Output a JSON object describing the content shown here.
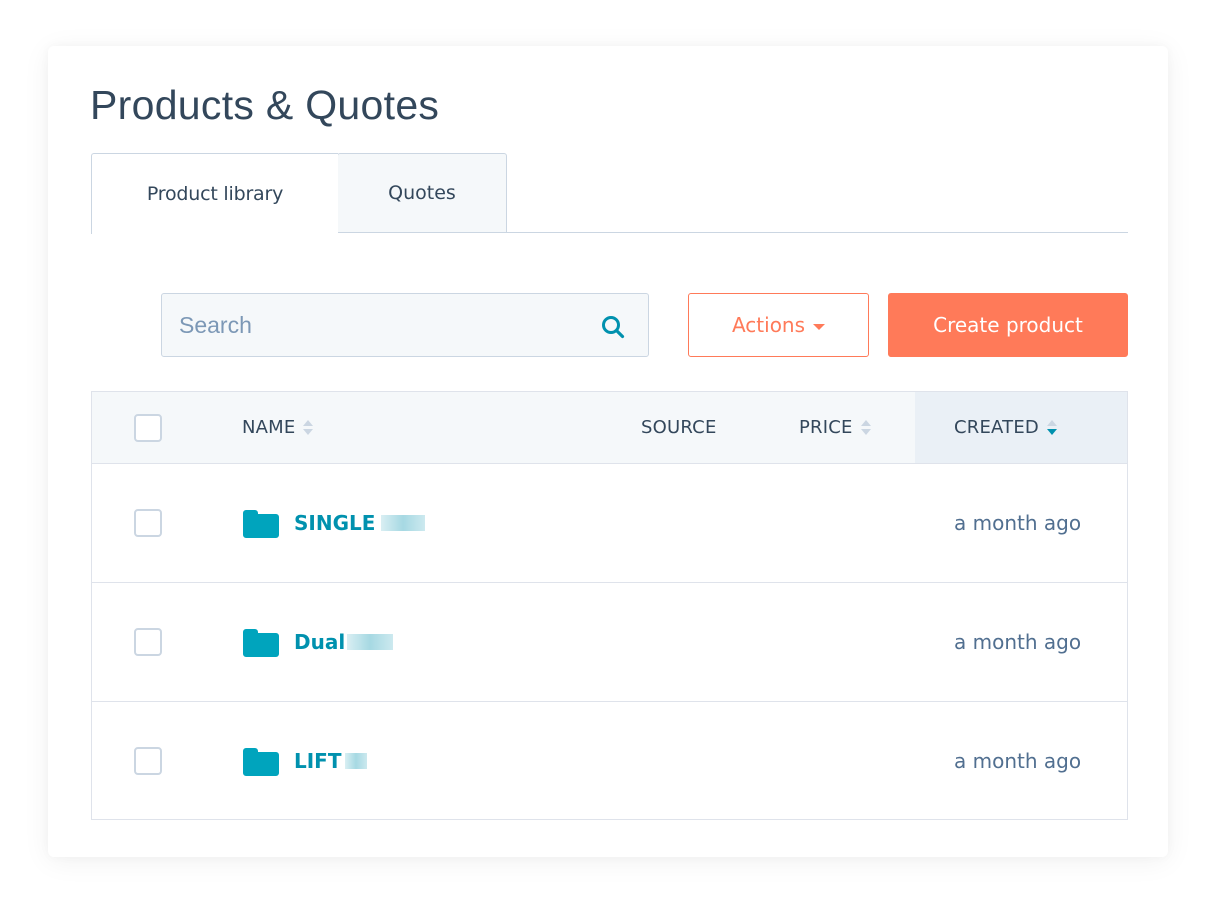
{
  "page": {
    "title": "Products & Quotes"
  },
  "tabs": [
    {
      "label": "Product library",
      "active": true
    },
    {
      "label": "Quotes",
      "active": false
    }
  ],
  "toolbar": {
    "search_placeholder": "Search",
    "search_value": "",
    "search_icon": "search-icon",
    "actions_label": "Actions",
    "create_label": "Create product"
  },
  "colors": {
    "accent": "#ff7a59",
    "link": "#0091ae",
    "text": "#33475b",
    "border": "#cbd6e2"
  },
  "table": {
    "columns": [
      {
        "label": "NAME",
        "sortable": true,
        "sort": "none"
      },
      {
        "label": "SOURCE",
        "sortable": false,
        "sort": "none"
      },
      {
        "label": "PRICE",
        "sortable": true,
        "sort": "none"
      },
      {
        "label": "CREATED",
        "sortable": true,
        "sort": "descending"
      }
    ],
    "rows": [
      {
        "icon": "folder-icon",
        "name": "SINGLE",
        "source": "",
        "price": "",
        "created": "a month ago"
      },
      {
        "icon": "folder-icon",
        "name": "Dual",
        "source": "",
        "price": "",
        "created": "a month ago"
      },
      {
        "icon": "folder-icon",
        "name": "LIFT",
        "source": "",
        "price": "",
        "created": "a month ago"
      }
    ]
  }
}
